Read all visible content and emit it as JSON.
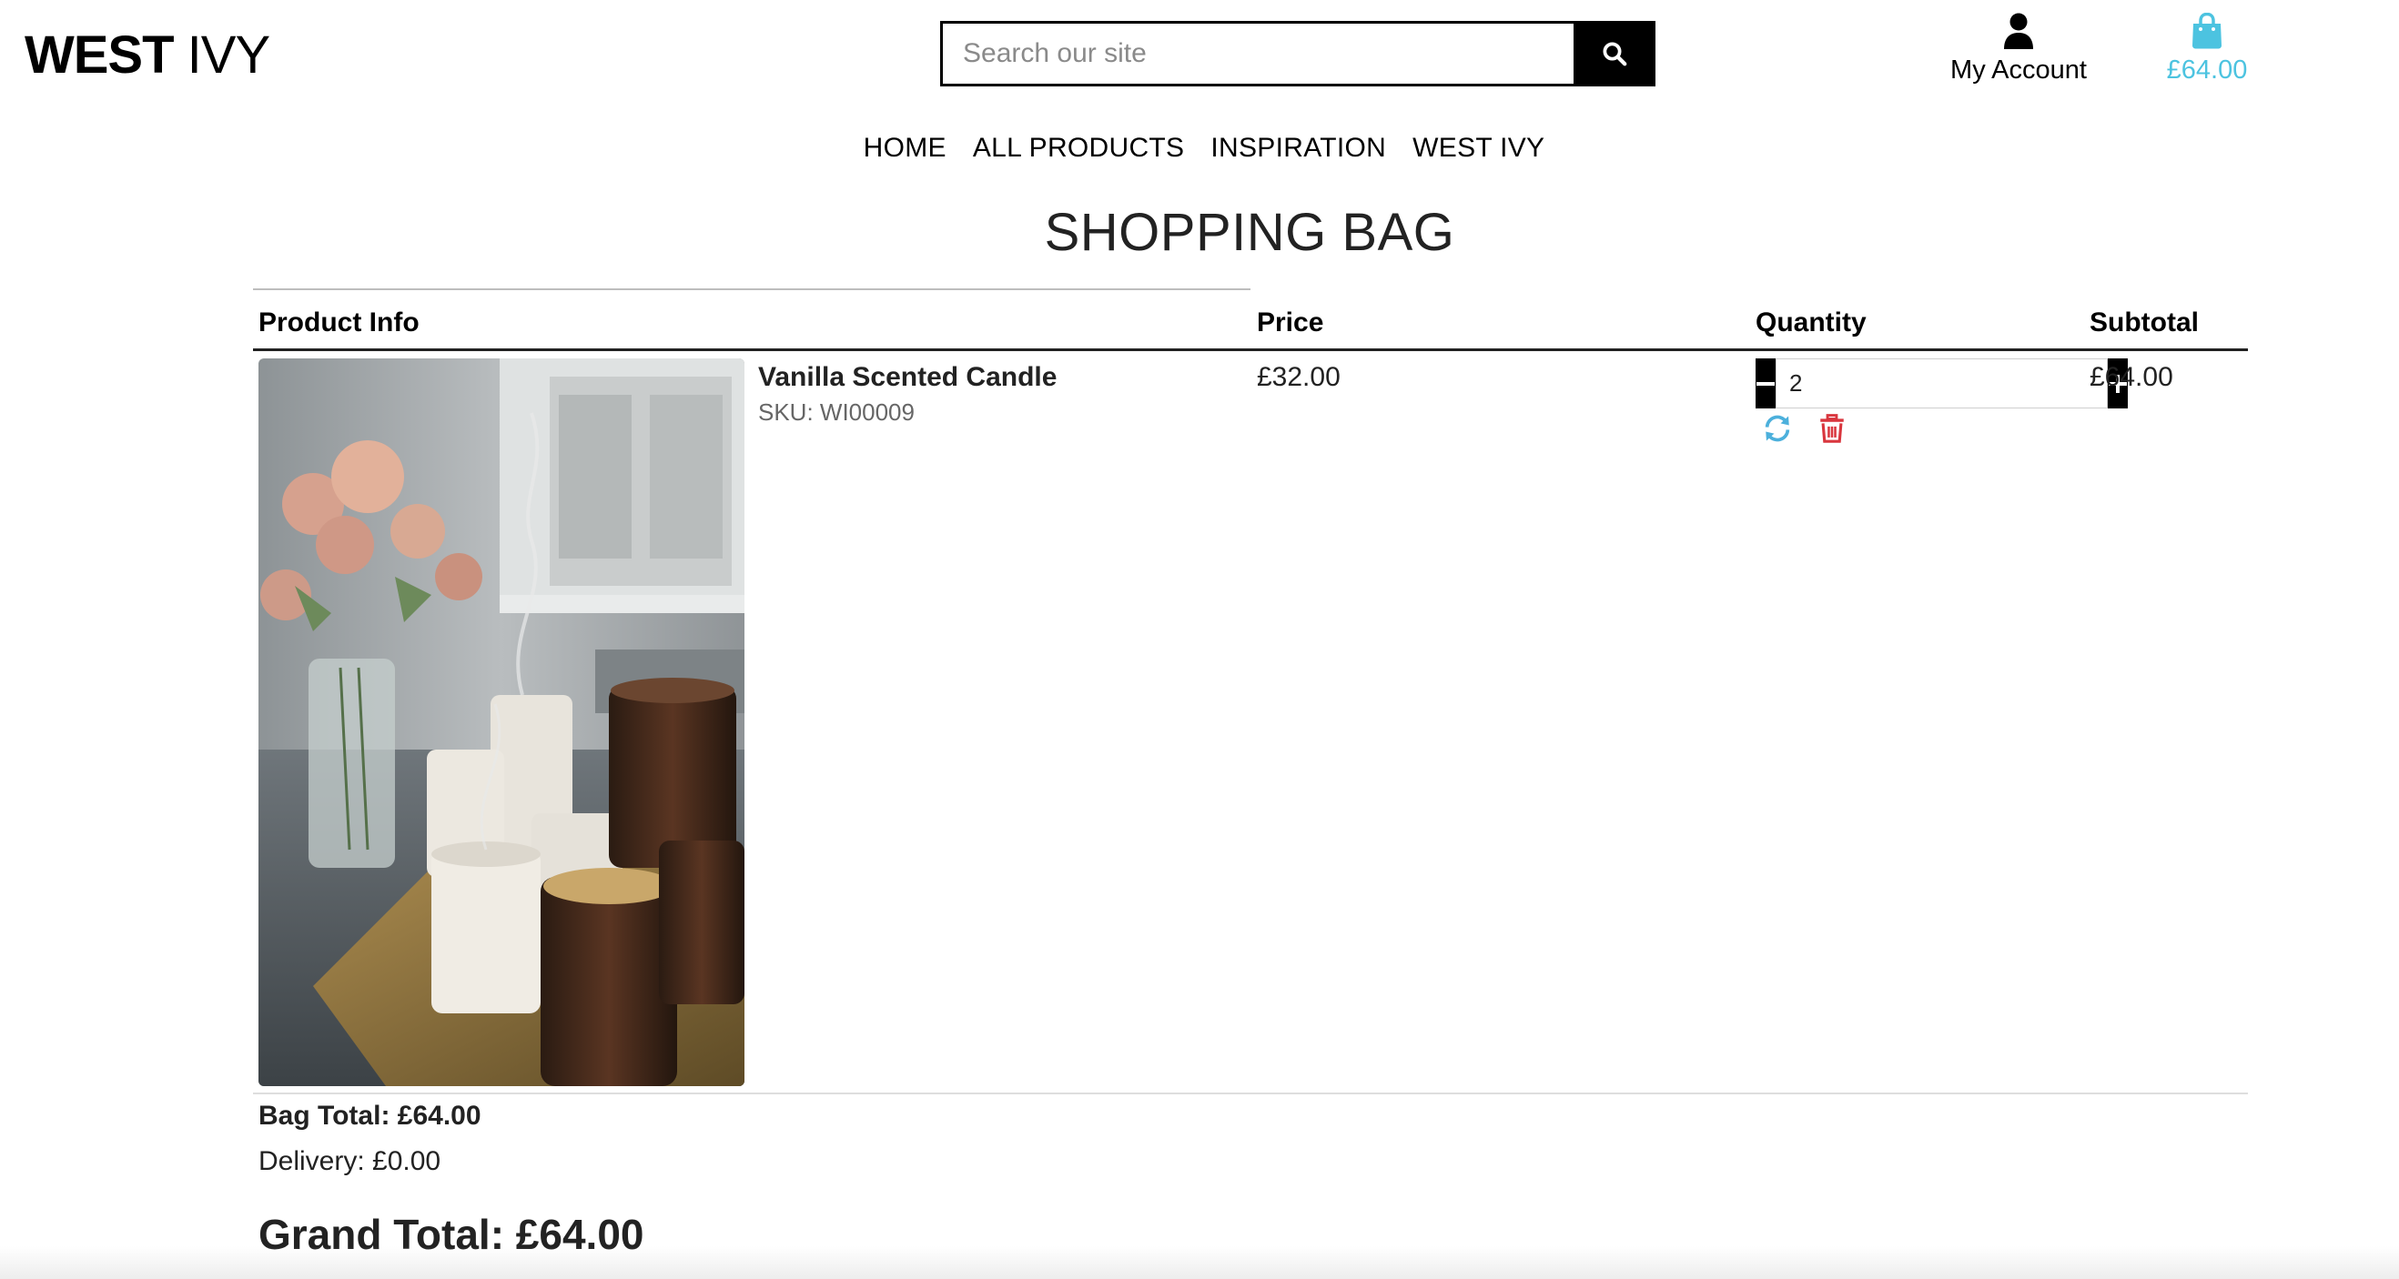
{
  "header": {
    "logo_bold": "WEST",
    "logo_light": "IVY",
    "search": {
      "placeholder": "Search our site",
      "icon": "search-icon"
    },
    "account_label": "My Account",
    "account_icon": "user-icon",
    "bag_amount": "£64.00",
    "bag_icon": "shopping-bag-icon",
    "accent_color": "#4cc3e0"
  },
  "nav": {
    "items": [
      {
        "label": "HOME"
      },
      {
        "label": "ALL PRODUCTS"
      },
      {
        "label": "INSPIRATION"
      },
      {
        "label": "WEST IVY"
      }
    ]
  },
  "page": {
    "title": "SHOPPING BAG"
  },
  "table": {
    "headers": {
      "product_info": "Product Info",
      "price": "Price",
      "quantity": "Quantity",
      "subtotal": "Subtotal"
    },
    "rows": [
      {
        "name": "Vanilla Scented Candle",
        "sku": "SKU: WI00009",
        "price": "£32.00",
        "quantity": "2",
        "subtotal": "£64.00",
        "image": "candles-and-flowers-photo"
      }
    ]
  },
  "totals": {
    "bag_total": "Bag Total: £64.00",
    "delivery": "Delivery: £0.00",
    "grand_total": "Grand Total: £64.00"
  },
  "colors": {
    "update_icon": "#4cb0dc",
    "remove_icon": "#d9363e"
  }
}
